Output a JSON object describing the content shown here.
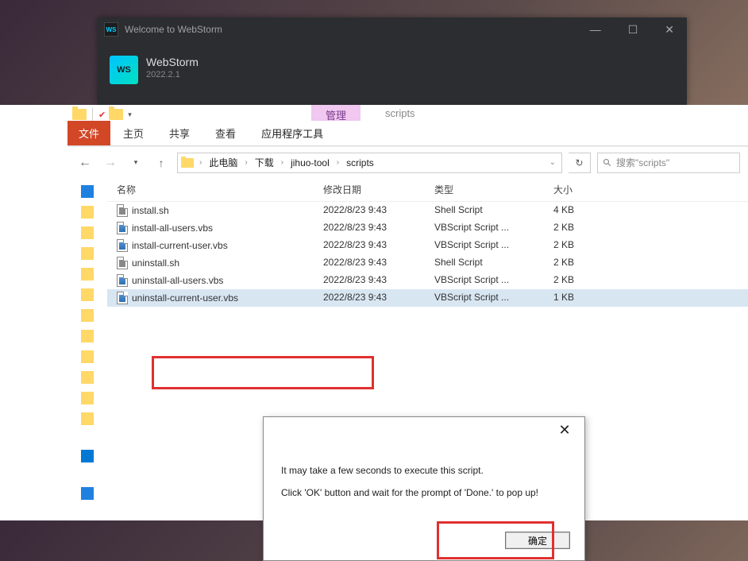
{
  "webstorm": {
    "titlebar_text": "Welcome to WebStorm",
    "ws_badge": "WS",
    "logo_text": "WS",
    "name": "WebStorm",
    "version": "2022.2.1"
  },
  "explorer": {
    "ribbon": {
      "file": "文件",
      "home": "主页",
      "share": "共享",
      "view": "查看",
      "manage_tab": "管理",
      "app_tools": "应用程序工具",
      "context_text": "scripts"
    },
    "breadcrumb": {
      "pc": "此电脑",
      "downloads": "下载",
      "folder1": "jihuo-tool",
      "folder2": "scripts"
    },
    "search_placeholder": "搜索\"scripts\"",
    "columns": {
      "name": "名称",
      "date": "修改日期",
      "type": "类型",
      "size": "大小"
    },
    "files": [
      {
        "name": "install.sh",
        "date": "2022/8/23 9:43",
        "type": "Shell Script",
        "size": "4 KB",
        "ext": "sh"
      },
      {
        "name": "install-all-users.vbs",
        "date": "2022/8/23 9:43",
        "type": "VBScript Script ...",
        "size": "2 KB",
        "ext": "vbs"
      },
      {
        "name": "install-current-user.vbs",
        "date": "2022/8/23 9:43",
        "type": "VBScript Script ...",
        "size": "2 KB",
        "ext": "vbs"
      },
      {
        "name": "uninstall.sh",
        "date": "2022/8/23 9:43",
        "type": "Shell Script",
        "size": "2 KB",
        "ext": "sh"
      },
      {
        "name": "uninstall-all-users.vbs",
        "date": "2022/8/23 9:43",
        "type": "VBScript Script ...",
        "size": "2 KB",
        "ext": "vbs"
      },
      {
        "name": "uninstall-current-user.vbs",
        "date": "2022/8/23 9:43",
        "type": "VBScript Script ...",
        "size": "1 KB",
        "ext": "vbs",
        "selected": true
      }
    ]
  },
  "dialog": {
    "line1": "It may take a few seconds to execute this script.",
    "line2": "Click 'OK' button and wait for the prompt of 'Done.' to pop up!",
    "ok_button": "确定"
  }
}
